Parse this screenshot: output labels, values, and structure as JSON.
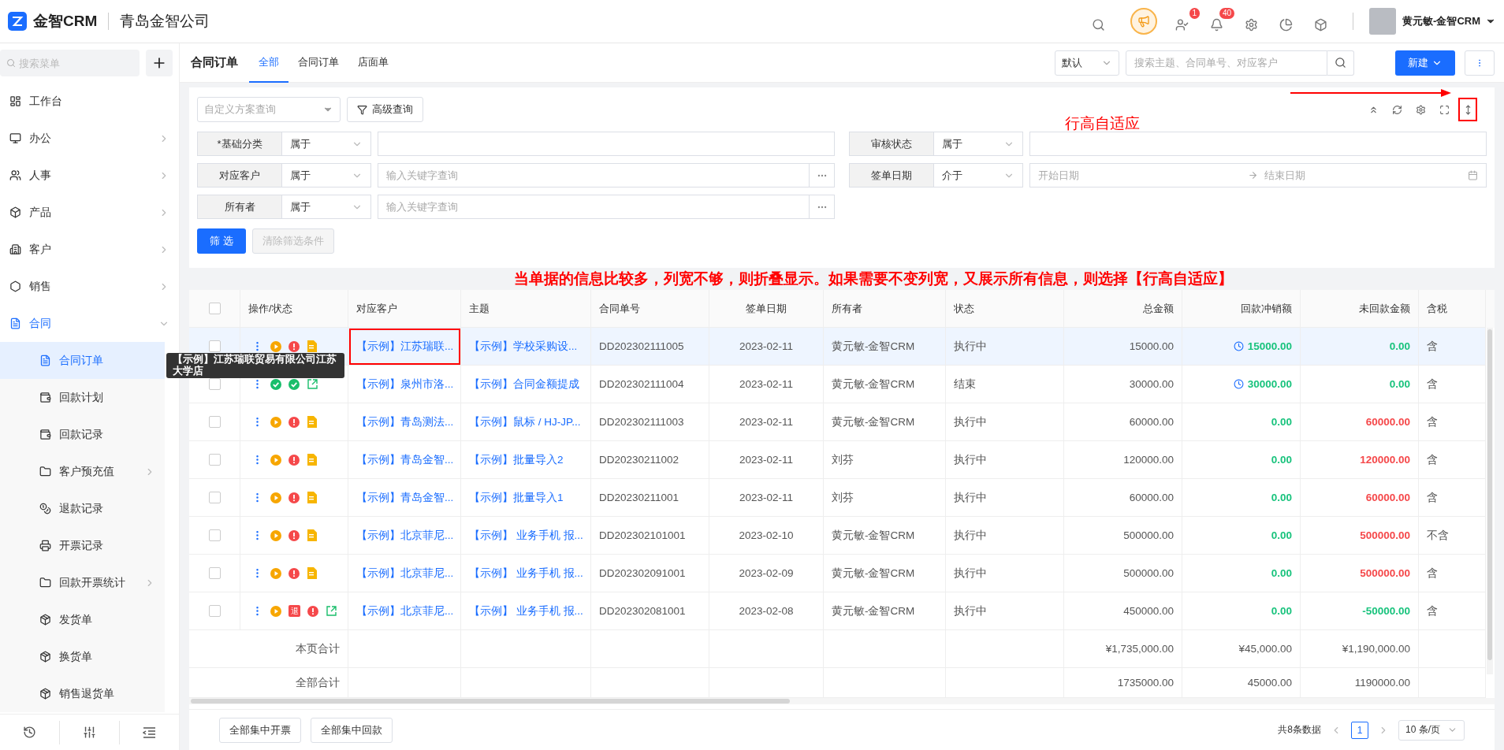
{
  "topbar": {
    "brand": "金智CRM",
    "company": "青岛金智公司",
    "tools": [
      {
        "kind": "search"
      },
      {
        "kind": "broadcast"
      },
      {
        "kind": "contacts",
        "badge": "1"
      },
      {
        "kind": "bell",
        "badge": "40"
      },
      {
        "kind": "settings"
      },
      {
        "kind": "pie"
      },
      {
        "kind": "cube"
      }
    ],
    "user": {
      "name": "黄元敏-金智CRM"
    }
  },
  "sidebar": {
    "search": {
      "placeholder": "搜索菜单"
    },
    "items": [
      {
        "label": "工作台",
        "selected": false
      },
      {
        "label": "办公",
        "selected": false,
        "expanded": false
      },
      {
        "label": "人事",
        "selected": false,
        "expanded": false
      },
      {
        "label": "产品",
        "selected": false,
        "expanded": false
      },
      {
        "label": "客户",
        "selected": false,
        "expanded": false
      },
      {
        "label": "销售",
        "selected": false,
        "expanded": false
      },
      {
        "label": "合同",
        "selected": false,
        "expanded": true,
        "children": [
          {
            "label": "合同订单",
            "selected": true
          },
          {
            "label": "回款计划",
            "selected": false
          },
          {
            "label": "回款记录",
            "selected": false
          },
          {
            "label": "客户预充值",
            "selected": false,
            "expanded": false
          },
          {
            "label": "退款记录",
            "selected": false
          },
          {
            "label": "开票记录",
            "selected": false
          },
          {
            "label": "回款开票统计",
            "selected": false,
            "expanded": false
          },
          {
            "label": "发货单",
            "selected": false
          },
          {
            "label": "换货单",
            "selected": false
          },
          {
            "label": "销售退货单",
            "selected": false
          }
        ]
      }
    ]
  },
  "page": {
    "title": "合同订单",
    "tabs": [
      {
        "label": "全部",
        "selected": true
      },
      {
        "label": "合同订单",
        "selected": false
      },
      {
        "label": "店面单",
        "selected": false
      }
    ],
    "view_select": "默认",
    "search": {
      "placeholder": "搜索主题、合同单号、对应客户"
    },
    "new_button": "新建"
  },
  "filters": {
    "scheme": {
      "placeholder": "自定义方案查询"
    },
    "advanced": "高级查询",
    "tools": [
      {
        "kind": "collapse",
        "boxed": false
      },
      {
        "kind": "refresh",
        "boxed": false
      },
      {
        "kind": "settings",
        "boxed": false
      },
      {
        "kind": "fullscreen",
        "boxed": false
      },
      {
        "kind": "row-height",
        "boxed": true
      }
    ],
    "tools_note": "行高自适应",
    "fields": [
      {
        "kind": "text",
        "label": "*基础分类",
        "operator": "属于"
      },
      {
        "kind": "text",
        "label": "审核状态",
        "operator": "属于"
      },
      {
        "kind": "lookup",
        "label": "对应客户",
        "operator": "属于",
        "placeholder": "输入关键字查询"
      },
      {
        "kind": "daterange",
        "label": "签单日期",
        "operator": "介于",
        "start": "开始日期",
        "end": "结束日期"
      },
      {
        "kind": "lookup",
        "label": "所有者",
        "operator": "属于",
        "placeholder": "输入关键字查询"
      }
    ],
    "apply": "筛 选",
    "clear": {
      "label": "清除筛选条件",
      "disabled": true
    }
  },
  "note": "当单据的信息比较多，列宽不够，则折叠显示。如果需要不变列宽，又展示所有信息，则选择【行高自适应】",
  "table": {
    "select_all": {
      "checked": false
    },
    "columns": [
      "操作/状态",
      "对应客户",
      "主题",
      "合同单号",
      "签单日期",
      "所有者",
      "状态",
      "总金额",
      "回款冲销额",
      "未回款金额",
      "含税"
    ],
    "rows": [
      {
        "selected": true,
        "checked": false,
        "icons": [
          {
            "kind": "more"
          },
          {
            "kind": "play"
          },
          {
            "kind": "alert"
          },
          {
            "kind": "doc"
          }
        ],
        "customer": "【示例】江苏瑞联...",
        "boxed": true,
        "subject": "【示例】学校采购设...",
        "number": "DD202302111005",
        "date": "2023-02-11",
        "owner": "黄元敏-金智CRM",
        "state": "执行中",
        "total": "15000.00",
        "repaid": {
          "text": "15000.00",
          "color": "#19c37d",
          "pending": true
        },
        "unpaid": {
          "text": "0.00",
          "color": "#19c37d"
        },
        "tax": "含"
      },
      {
        "selected": false,
        "checked": false,
        "icons": [
          {
            "kind": "more"
          },
          {
            "kind": "check"
          },
          {
            "kind": "check"
          },
          {
            "kind": "share"
          }
        ],
        "customer": "【示例】泉州市洛...",
        "boxed": false,
        "subject": "【示例】合同金额提成",
        "number": "DD202302111004",
        "date": "2023-02-11",
        "owner": "黄元敏-金智CRM",
        "state": "结束",
        "total": "30000.00",
        "repaid": {
          "text": "30000.00",
          "color": "#19c37d",
          "pending": true
        },
        "unpaid": {
          "text": "0.00",
          "color": "#19c37d"
        },
        "tax": "含"
      },
      {
        "selected": false,
        "checked": false,
        "icons": [
          {
            "kind": "more"
          },
          {
            "kind": "play"
          },
          {
            "kind": "alert"
          },
          {
            "kind": "doc"
          }
        ],
        "customer": "【示例】青岛测法...",
        "boxed": false,
        "subject": "【示例】鼠标 / HJ-JP...",
        "number": "DD202302111003",
        "date": "2023-02-11",
        "owner": "黄元敏-金智CRM",
        "state": "执行中",
        "total": "60000.00",
        "repaid": {
          "text": "0.00",
          "color": "#19c37d",
          "pending": false
        },
        "unpaid": {
          "text": "60000.00",
          "color": "#f5484a"
        },
        "tax": "含"
      },
      {
        "selected": false,
        "checked": false,
        "icons": [
          {
            "kind": "more"
          },
          {
            "kind": "play"
          },
          {
            "kind": "alert"
          },
          {
            "kind": "doc"
          }
        ],
        "customer": "【示例】青岛金智...",
        "boxed": false,
        "subject": "【示例】批量导入2",
        "number": "DD20230211002",
        "date": "2023-02-11",
        "owner": "刘芬",
        "state": "执行中",
        "total": "120000.00",
        "repaid": {
          "text": "0.00",
          "color": "#19c37d",
          "pending": false
        },
        "unpaid": {
          "text": "120000.00",
          "color": "#f5484a"
        },
        "tax": "含"
      },
      {
        "selected": false,
        "checked": false,
        "icons": [
          {
            "kind": "more"
          },
          {
            "kind": "play"
          },
          {
            "kind": "alert"
          },
          {
            "kind": "doc"
          }
        ],
        "customer": "【示例】青岛金智...",
        "boxed": false,
        "subject": "【示例】批量导入1",
        "number": "DD20230211001",
        "date": "2023-02-11",
        "owner": "刘芬",
        "state": "执行中",
        "total": "60000.00",
        "repaid": {
          "text": "0.00",
          "color": "#19c37d",
          "pending": false
        },
        "unpaid": {
          "text": "60000.00",
          "color": "#f5484a"
        },
        "tax": "含"
      },
      {
        "selected": false,
        "checked": false,
        "icons": [
          {
            "kind": "more"
          },
          {
            "kind": "play"
          },
          {
            "kind": "alert"
          },
          {
            "kind": "doc"
          }
        ],
        "customer": "【示例】北京菲尼...",
        "boxed": false,
        "subject": "【示例】 业务手机 报...",
        "number": "DD202302101001",
        "date": "2023-02-10",
        "owner": "黄元敏-金智CRM",
        "state": "执行中",
        "total": "500000.00",
        "repaid": {
          "text": "0.00",
          "color": "#19c37d",
          "pending": false
        },
        "unpaid": {
          "text": "500000.00",
          "color": "#f5484a"
        },
        "tax": "不含"
      },
      {
        "selected": false,
        "checked": false,
        "icons": [
          {
            "kind": "more"
          },
          {
            "kind": "play"
          },
          {
            "kind": "alert"
          },
          {
            "kind": "doc"
          }
        ],
        "customer": "【示例】北京菲尼...",
        "boxed": false,
        "subject": "【示例】 业务手机 报...",
        "number": "DD202302091001",
        "date": "2023-02-09",
        "owner": "黄元敏-金智CRM",
        "state": "执行中",
        "total": "500000.00",
        "repaid": {
          "text": "0.00",
          "color": "#19c37d",
          "pending": false
        },
        "unpaid": {
          "text": "500000.00",
          "color": "#f5484a"
        },
        "tax": "含"
      },
      {
        "selected": false,
        "checked": false,
        "icons": [
          {
            "kind": "more"
          },
          {
            "kind": "play"
          },
          {
            "kind": "refund",
            "label": "退"
          },
          {
            "kind": "alert"
          },
          {
            "kind": "share"
          }
        ],
        "customer": "【示例】北京菲尼...",
        "boxed": false,
        "subject": "【示例】 业务手机 报...",
        "number": "DD202302081001",
        "date": "2023-02-08",
        "owner": "黄元敏-金智CRM",
        "state": "执行中",
        "total": "450000.00",
        "repaid": {
          "text": "0.00",
          "color": "#19c37d",
          "pending": false
        },
        "unpaid": {
          "text": "-50000.00",
          "color": "#19c37d"
        },
        "tax": "含"
      }
    ],
    "summaries": [
      {
        "label": "本页合计",
        "total": "¥1,735,000.00",
        "repaid": "¥45,000.00",
        "unpaid": "¥1,190,000.00"
      },
      {
        "label": "全部合计",
        "total": "1735000.00",
        "repaid": "45000.00",
        "unpaid": "1190000.00"
      }
    ]
  },
  "tooltip": "【示例】江苏瑞联贸易有限公司江苏大学店",
  "footer": {
    "buttons": [
      "全部集中开票",
      "全部集中回款"
    ],
    "total": "共8条数据",
    "pages": [
      {
        "label": "1",
        "selected": true
      }
    ],
    "page_size": "10 条/页"
  }
}
